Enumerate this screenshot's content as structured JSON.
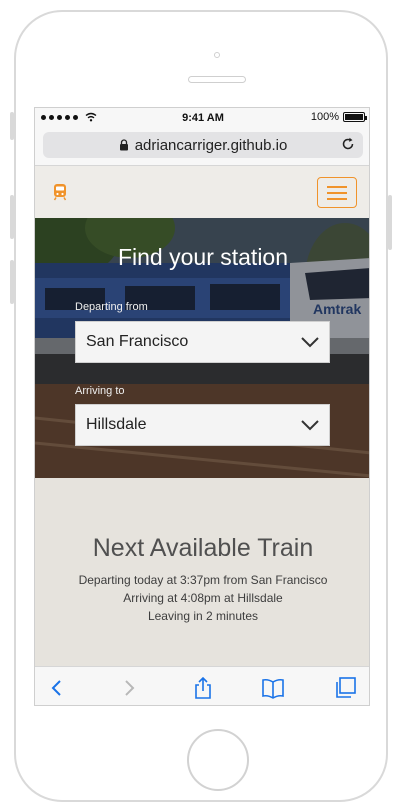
{
  "status_bar": {
    "time": "9:41 AM",
    "battery": "100%"
  },
  "browser": {
    "url": "adriancarriger.github.io"
  },
  "hero": {
    "title": "Find your station",
    "departing_label": "Departing from",
    "departing_value": "San Francisco",
    "arriving_label": "Arriving to",
    "arriving_value": "Hillsdale",
    "train_brand": "Amtrak"
  },
  "next_train": {
    "title": "Next Available Train",
    "departing": "Departing today at 3:37pm from San Francisco",
    "arriving": "Arriving at 4:08pm at Hillsdale",
    "leaving": "Leaving in 2 minutes"
  },
  "colors": {
    "accent": "#f0932b",
    "ios_blue": "#1a73e8",
    "page_bg": "#e6e3dd"
  },
  "icons": [
    "signal-icon",
    "wifi-icon",
    "battery-icon",
    "lock-icon",
    "reload-icon",
    "train-logo-icon",
    "hamburger-menu-icon",
    "chevron-down-icon",
    "back-icon",
    "forward-icon",
    "share-icon",
    "bookmarks-icon",
    "tabs-icon"
  ]
}
